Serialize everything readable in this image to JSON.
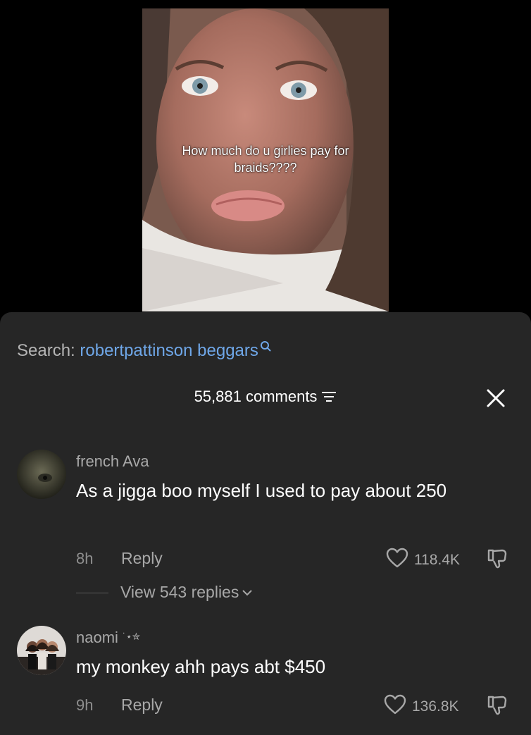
{
  "video": {
    "caption": "How much do u girlies pay for braids????"
  },
  "search": {
    "label": "Search:",
    "query": "robertpattinson beggars",
    "query_color": "#6fa7e8"
  },
  "comments_header": {
    "count_label": "55,881 comments"
  },
  "comments": [
    {
      "username": "french Ava",
      "text": "As a jigga boo myself I used to pay about 250",
      "time": "8h",
      "reply_label": "Reply",
      "likes": "118.4K",
      "view_replies": "View 543 replies"
    },
    {
      "username": "naomi",
      "username_decor": "˙⋆✮",
      "text": "my monkey ahh pays abt $450",
      "time": "9h",
      "reply_label": "Reply",
      "likes": "136.8K"
    }
  ],
  "icons": {
    "search": "search-icon",
    "filter": "filter-icon",
    "close": "close-icon",
    "like": "heart-outline-icon",
    "dislike": "thumbs-down-icon",
    "chevron": "chevron-down-icon"
  },
  "colors": {
    "sheet_bg": "#262626",
    "page_bg": "#000000",
    "secondary_text": "#a8a8a8"
  }
}
